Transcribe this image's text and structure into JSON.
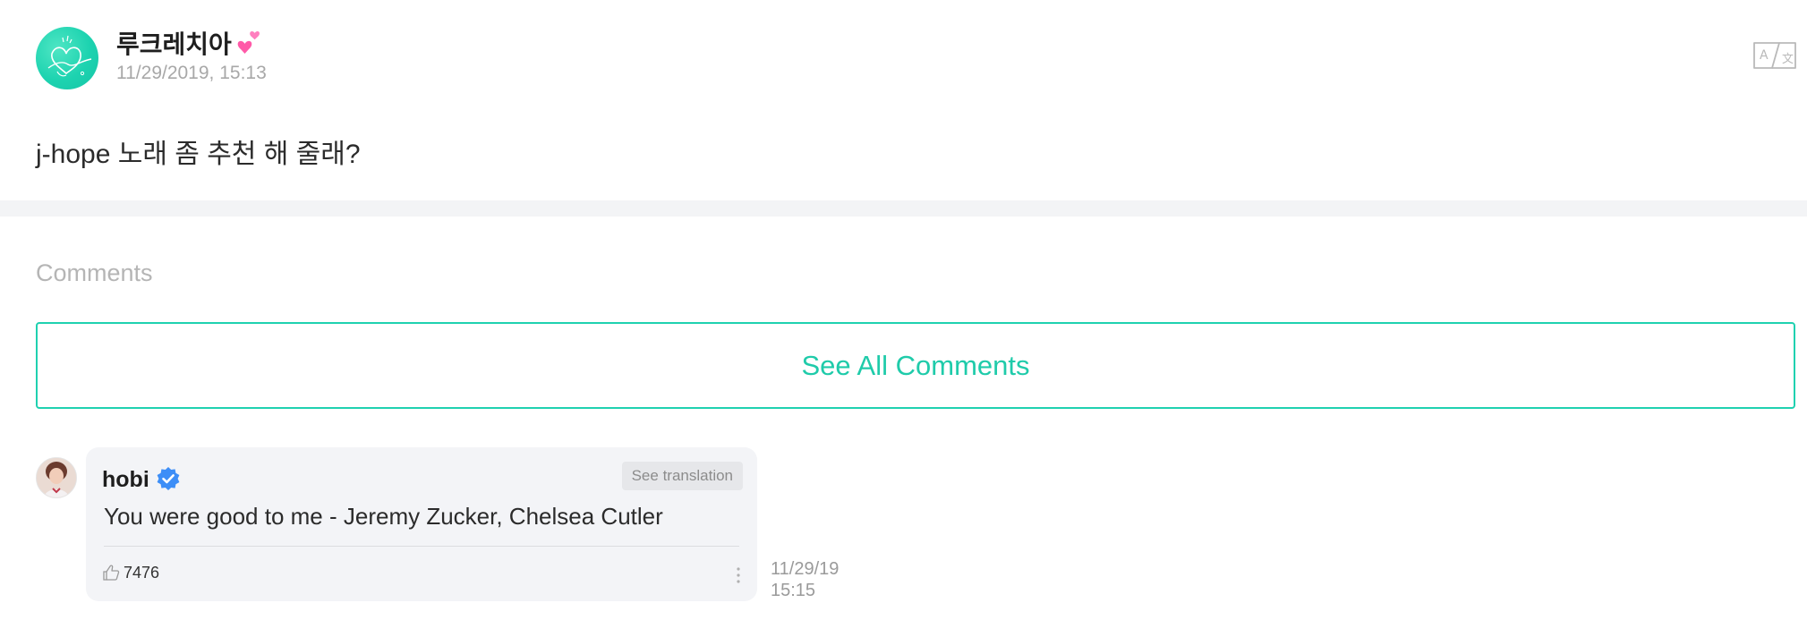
{
  "post": {
    "author": "루크레치아",
    "date": "11/29/2019, 15:13",
    "body": "j-hope 노래 좀 추천 해 줄래?",
    "icons": {
      "avatar": "signature-logo-avatar",
      "name_suffix": "two-hearts-icon",
      "translate": "translate-icon"
    }
  },
  "comments": {
    "heading": "Comments",
    "see_all_label": "See All Comments",
    "items": [
      {
        "author": "hobi",
        "verified": true,
        "see_translation_label": "See translation",
        "text": "You were good to me - Jeremy Zucker, Chelsea Cutler",
        "likes": "7476",
        "date_line1": "11/29/19",
        "date_line2": "15:15"
      }
    ]
  },
  "colors": {
    "accent": "#1fd1b0",
    "muted": "#a8a8a8",
    "verified_blue": "#3d8ef7",
    "bubble_bg": "#f3f4f7"
  }
}
